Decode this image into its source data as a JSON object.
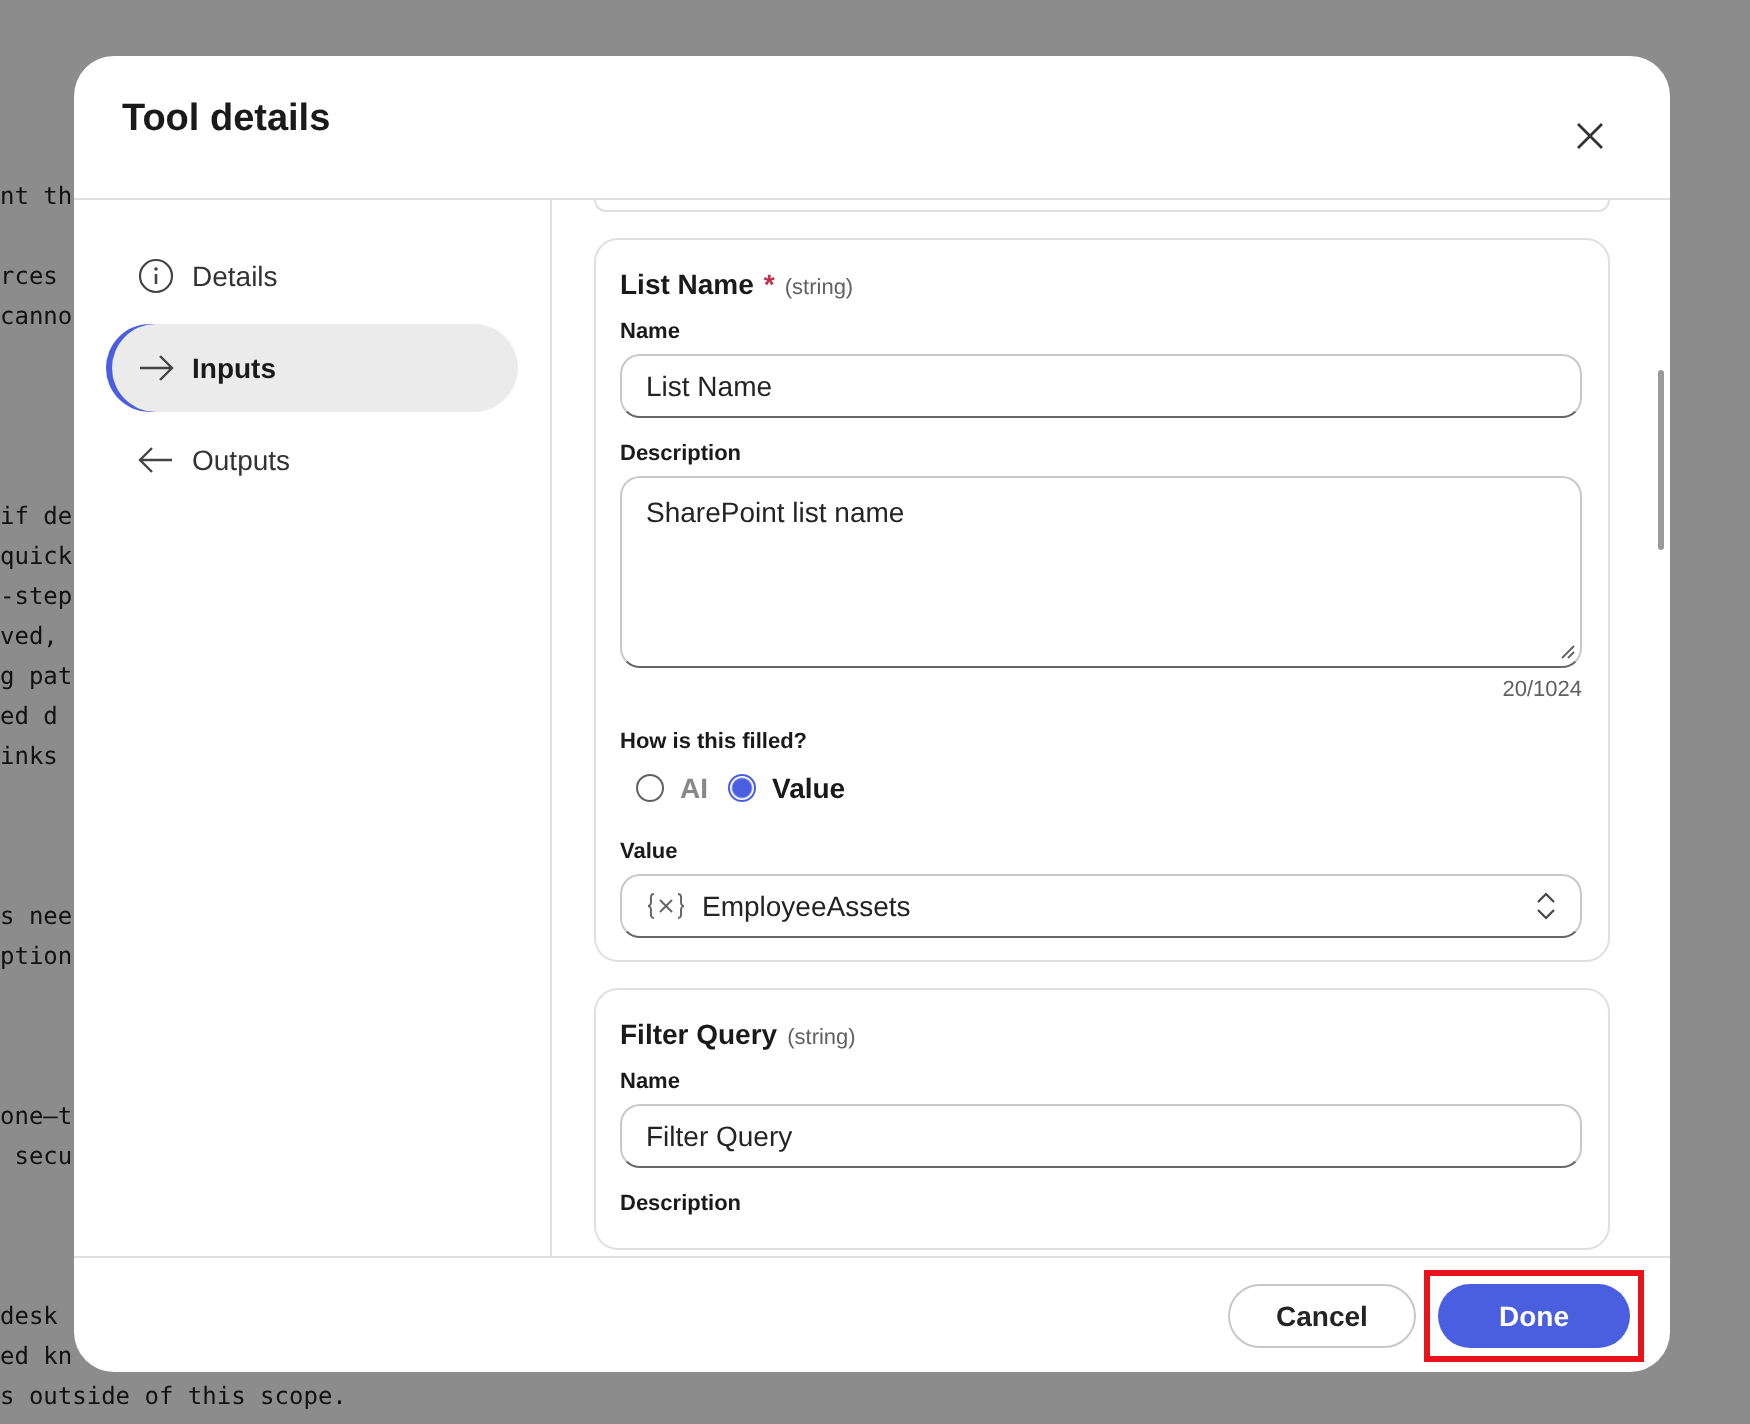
{
  "background_text": [
    [
      "nt th"
    ],
    [
      "rces",
      "canno"
    ],
    [
      "if de",
      "quick",
      "-step",
      "ved,",
      "g pat",
      "ed d",
      "inks"
    ],
    [
      "s nee",
      "ption"
    ],
    [
      "one–t",
      " secu"
    ],
    [
      "desk",
      "ed kn",
      "s outside of this scope."
    ]
  ],
  "dialog": {
    "title": "Tool details",
    "nav": [
      {
        "label": "Details",
        "kind": "info",
        "selected": false
      },
      {
        "label": "Inputs",
        "kind": "forward",
        "selected": true
      },
      {
        "label": "Outputs",
        "kind": "back",
        "selected": false
      }
    ],
    "inputs": [
      {
        "title": "List Name",
        "required_mark": "*",
        "type": "(string)",
        "name_label": "Name",
        "name_value": "List Name",
        "description_label": "Description",
        "description_value": "SharePoint list name",
        "counter": "20/1024",
        "fill_label": "How is this filled?",
        "fill_options": [
          {
            "label": "AI",
            "selected": false
          },
          {
            "label": "Value",
            "selected": true
          }
        ],
        "value_label": "Value",
        "value": "EmployeeAssets"
      },
      {
        "title": "Filter Query",
        "type": "(string)",
        "name_label": "Name",
        "name_value": "Filter Query",
        "description_label": "Description"
      }
    ],
    "buttons": [
      {
        "label": "Cancel",
        "kind": "secondary",
        "highlighted": false
      },
      {
        "label": "Done",
        "kind": "primary",
        "highlighted": true
      }
    ]
  }
}
